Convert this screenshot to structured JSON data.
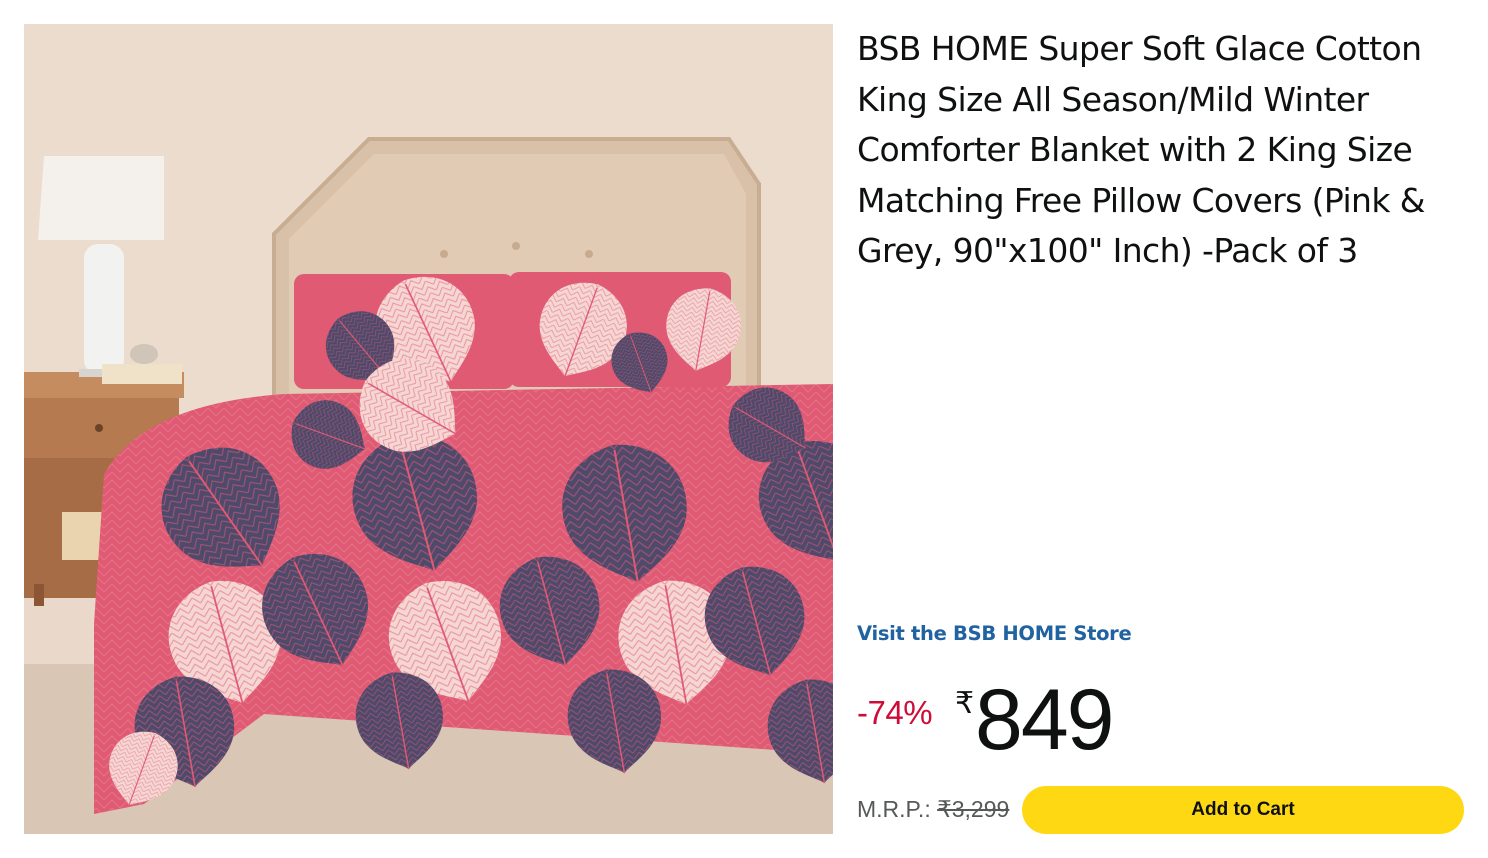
{
  "product": {
    "title": "BSB HOME Super Soft Glace Cotton King Size All Season/Mild Winter Comforter Blanket with 2 King Size Matching Free Pillow Covers (Pink & Grey, 90\"x100\" Inch) -Pack of 3",
    "image_icon": "bedroom-comforter-photo",
    "store_link": "Visit the BSB HOME Store",
    "discount": "-74%",
    "currency_symbol": "₹",
    "price": "849",
    "mrp_label": "M.R.P.:",
    "mrp_value": "₹3,299",
    "add_to_cart_label": "Add to Cart"
  },
  "colors": {
    "discount": "#cc0c39",
    "link": "#2162a1",
    "button": "#ffd814",
    "comforter_pink": "#e05a74",
    "leaf_grey": "#4d4a6b",
    "leaf_light": "#f4d6d2"
  }
}
